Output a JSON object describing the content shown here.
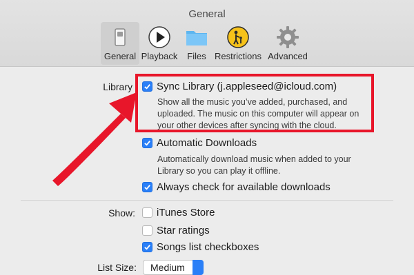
{
  "window": {
    "title": "General"
  },
  "toolbar": {
    "tabs": [
      {
        "label": "General",
        "icon": "general-switch-icon",
        "selected": true
      },
      {
        "label": "Playback",
        "icon": "play-icon",
        "selected": false
      },
      {
        "label": "Files",
        "icon": "folder-icon",
        "selected": false
      },
      {
        "label": "Restrictions",
        "icon": "restrictions-icon",
        "selected": false
      },
      {
        "label": "Advanced",
        "icon": "gear-icon",
        "selected": false
      }
    ]
  },
  "library": {
    "label": "Library",
    "sync_library": {
      "label": "Sync Library (j.appleseed@icloud.com)",
      "checked": true,
      "description": "Show all the music you’ve added, purchased, and uploaded. The music on this computer will appear on your other devices after syncing with the cloud."
    },
    "automatic_downloads": {
      "label": "Automatic Downloads",
      "checked": true,
      "description": "Automatically download music when added to your Library so you can play it offline."
    },
    "always_check": {
      "label": "Always check for available downloads",
      "checked": true
    }
  },
  "show": {
    "label": "Show:",
    "itunes_store": {
      "label": "iTunes Store",
      "checked": false
    },
    "star_ratings": {
      "label": "Star ratings",
      "checked": false
    },
    "songs_list_checkboxes": {
      "label": "Songs list checkboxes",
      "checked": true
    }
  },
  "list_size": {
    "label": "List Size:",
    "value": "Medium"
  },
  "colors": {
    "accent": "#2a7ff7",
    "annotation": "#e8162a"
  }
}
